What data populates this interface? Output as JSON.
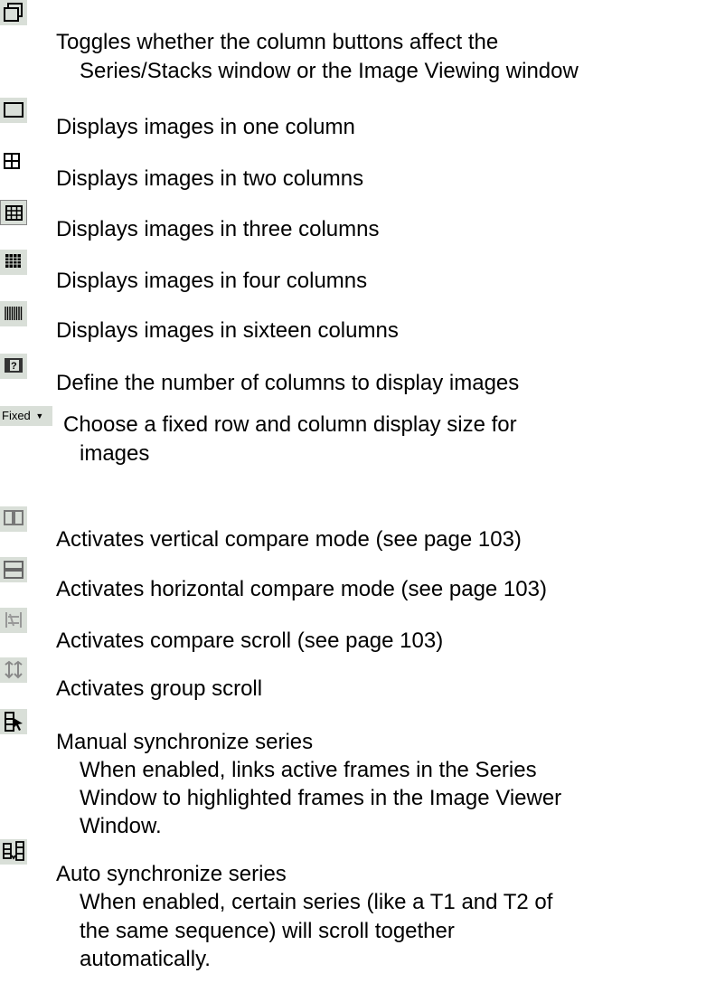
{
  "items": [
    {
      "icon": "toggle-window-icon",
      "lines": [
        "Toggles whether the column buttons affect the",
        "Series/Stacks window or the Image Viewing window"
      ]
    },
    {
      "icon": "one-column-icon",
      "lines": [
        "Displays images in one column"
      ]
    },
    {
      "icon": "two-columns-icon",
      "lines": [
        "Displays images in two columns"
      ]
    },
    {
      "icon": "three-columns-icon",
      "lines": [
        "Displays images in three columns"
      ]
    },
    {
      "icon": "four-columns-icon",
      "lines": [
        "Displays images in four columns"
      ]
    },
    {
      "icon": "sixteen-columns-icon",
      "lines": [
        "Displays images in sixteen columns"
      ]
    },
    {
      "icon": "custom-columns-icon",
      "lines": [
        "Define the number of columns to display images"
      ]
    },
    {
      "icon": "fixed-dropdown",
      "button_label": "Fixed",
      "lines": [
        "Choose a fixed row and column display size for",
        "images"
      ]
    },
    {
      "icon": "vertical-compare-icon",
      "lines": [
        "Activates vertical compare mode (see page 103)"
      ]
    },
    {
      "icon": "horizontal-compare-icon",
      "lines": [
        "Activates horizontal compare mode (see page 103)"
      ]
    },
    {
      "icon": "compare-scroll-icon",
      "lines": [
        "Activates compare scroll (see page 103)"
      ]
    },
    {
      "icon": "group-scroll-icon",
      "lines": [
        "Activates group scroll"
      ]
    },
    {
      "icon": "manual-sync-icon",
      "lines": [
        "Manual synchronize series",
        "When enabled, links active frames in the Series",
        "Window to highlighted frames in the Image Viewer",
        "Window."
      ]
    },
    {
      "icon": "auto-sync-icon",
      "lines": [
        "Auto synchronize series",
        "When enabled, certain series (like a T1 and T2 of",
        "the same sequence) will scroll together",
        "automatically."
      ]
    }
  ]
}
